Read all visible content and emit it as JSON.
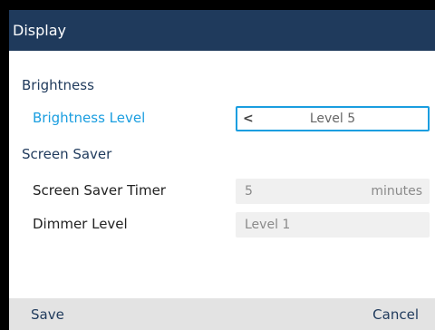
{
  "title": "Display",
  "sections": {
    "brightness": "Brightness",
    "screen_saver": "Screen Saver"
  },
  "rows": {
    "brightness_level": {
      "label": "Brightness Level",
      "value": "Level 5"
    },
    "screen_saver_timer": {
      "label": "Screen Saver Timer",
      "value": "5",
      "unit": "minutes"
    },
    "dimmer_level": {
      "label": "Dimmer Level",
      "value": "Level 1"
    }
  },
  "softkeys": {
    "save": "Save",
    "cancel": "Cancel"
  },
  "colors": {
    "titlebar": "#1f3a5c",
    "accent": "#1a9ee0"
  },
  "icons": {
    "brightness_chevron": "chevron-left-icon"
  }
}
